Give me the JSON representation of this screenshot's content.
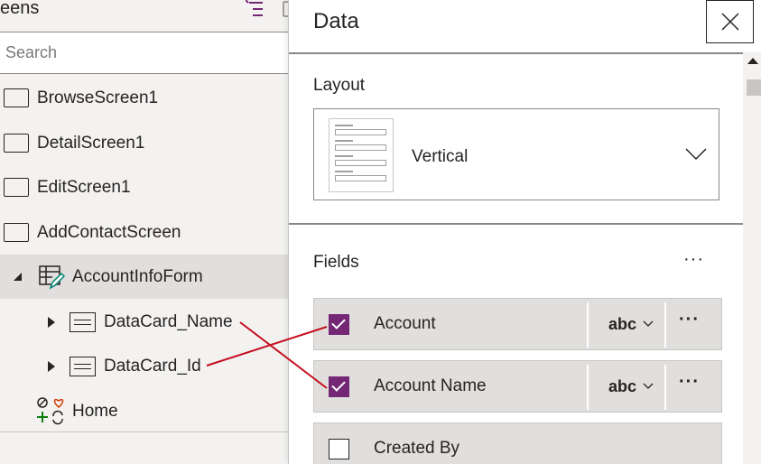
{
  "tree": {
    "title": "eens",
    "search_placeholder": "Search",
    "screens": [
      {
        "label": "BrowseScreen1"
      },
      {
        "label": "DetailScreen1"
      },
      {
        "label": "EditScreen1"
      },
      {
        "label": "AddContactScreen"
      }
    ],
    "form": {
      "label": "AccountInfoForm"
    },
    "cards": [
      {
        "label": "DataCard_Name"
      },
      {
        "label": "DataCard_Id"
      }
    ],
    "home": {
      "label": "Home"
    }
  },
  "pane": {
    "title": "Data",
    "close_icon": "close-icon",
    "layout": {
      "label": "Layout",
      "value": "Vertical"
    },
    "fields": {
      "label": "Fields",
      "more": "···",
      "rows": [
        {
          "name": "Account",
          "checked": true,
          "type": "abc",
          "more": "···"
        },
        {
          "name": "Account Name",
          "checked": true,
          "type": "abc",
          "more": "···"
        },
        {
          "name": "Created By",
          "checked": false
        }
      ]
    }
  },
  "colors": {
    "accent": "#742774",
    "connector": "#c50f1f",
    "selected_bg": "#e1dfdd"
  }
}
